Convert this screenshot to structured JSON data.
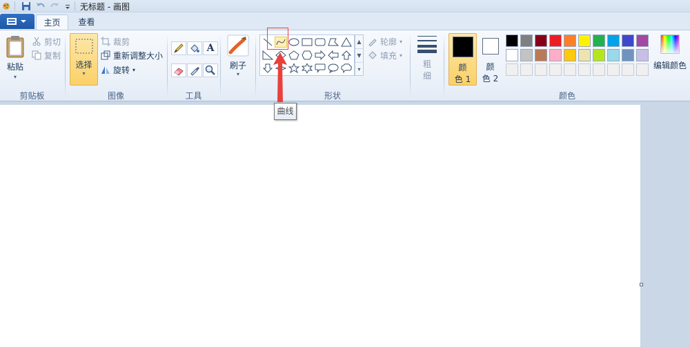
{
  "titlebar": {
    "title": "无标题 - 画图"
  },
  "tabs": [
    {
      "label": "主页"
    },
    {
      "label": "查看"
    }
  ],
  "clipboard": {
    "paste_label": "粘贴",
    "cut_label": "剪切",
    "copy_label": "复制",
    "group_label": "剪贴板"
  },
  "image": {
    "select_label": "选择",
    "crop_label": "裁剪",
    "resize_label": "重新调整大小",
    "rotate_label": "旋转",
    "group_label": "图像"
  },
  "tools": {
    "group_label": "工具",
    "text_tool": "A"
  },
  "brush": {
    "label": "刷子"
  },
  "shapes": {
    "outline_label": "轮廓",
    "fill_label": "填充",
    "group_label": "形状",
    "tooltip": "曲线"
  },
  "size": {
    "label_line1": "粗",
    "label_line2": "细"
  },
  "colors": {
    "color1_line1": "颜",
    "color1_line2": "色 1",
    "color2_line1": "颜",
    "color2_line2": "色 2",
    "edit_label": "编辑颜色",
    "group_label": "颜色",
    "color1_value": "#000000",
    "color2_value": "#ffffff",
    "palette_row1": [
      "#000000",
      "#7f7f7f",
      "#880015",
      "#ed1c24",
      "#ff7f27",
      "#fff200",
      "#22b14c",
      "#00a2e8",
      "#3f48cc",
      "#a349a4"
    ],
    "palette_row2": [
      "#ffffff",
      "#c3c3c3",
      "#b97a57",
      "#ffaec9",
      "#ffc90e",
      "#efe4b0",
      "#b5e61d",
      "#99d9ea",
      "#7092be",
      "#c8bfe7"
    ],
    "palette_row3": [
      "#f0f0f0",
      "#f0f0f0",
      "#f0f0f0",
      "#f0f0f0",
      "#f0f0f0",
      "#f0f0f0",
      "#f0f0f0",
      "#f0f0f0",
      "#f0f0f0",
      "#f0f0f0"
    ]
  }
}
